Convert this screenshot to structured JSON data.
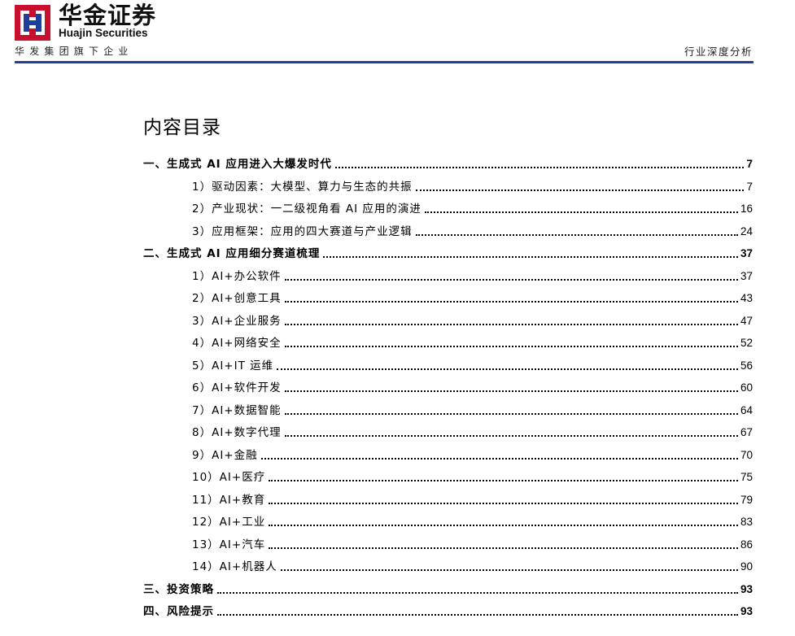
{
  "header": {
    "brand_cn": "华金证券",
    "brand_en": "Huajin Securities",
    "group_line": "华发集团旗下企业",
    "report_type": "行业深度分析",
    "brand_color": "#c8102e",
    "accent_color": "#1f3f9a"
  },
  "toc": {
    "title": "内容目录",
    "entries": [
      {
        "text": "一、生成式 AI 应用进入大爆发时代",
        "page": "7"
      },
      {
        "text": "1）驱动因素：大模型、算力与生态的共振",
        "page": "7"
      },
      {
        "text": "2）产业现状：一二级视角看 AI 应用的演进",
        "page": "16"
      },
      {
        "text": "3）应用框架：应用的四大赛道与产业逻辑",
        "page": "24"
      },
      {
        "text": "二、生成式 AI 应用细分赛道梳理",
        "page": "37"
      },
      {
        "text": "1）AI+办公软件",
        "page": "37"
      },
      {
        "text": "2）AI+创意工具",
        "page": "43"
      },
      {
        "text": "3）AI+企业服务",
        "page": "47"
      },
      {
        "text": "4）AI+网络安全",
        "page": "52"
      },
      {
        "text": "5）AI+IT 运维",
        "page": "56"
      },
      {
        "text": "6）AI+软件开发",
        "page": "60"
      },
      {
        "text": "7）AI+数据智能",
        "page": "64"
      },
      {
        "text": "8）AI+数字代理",
        "page": "67"
      },
      {
        "text": "9）AI+金融",
        "page": "70"
      },
      {
        "text": "10）AI+医疗",
        "page": "75"
      },
      {
        "text": "11）AI+教育",
        "page": "79"
      },
      {
        "text": "12）AI+工业",
        "page": "83"
      },
      {
        "text": "13）AI+汽车",
        "page": "86"
      },
      {
        "text": "14）AI+机器人",
        "page": "90"
      },
      {
        "text": "三、投资策略",
        "page": "93"
      },
      {
        "text": "四、风险提示",
        "page": "93"
      }
    ]
  }
}
